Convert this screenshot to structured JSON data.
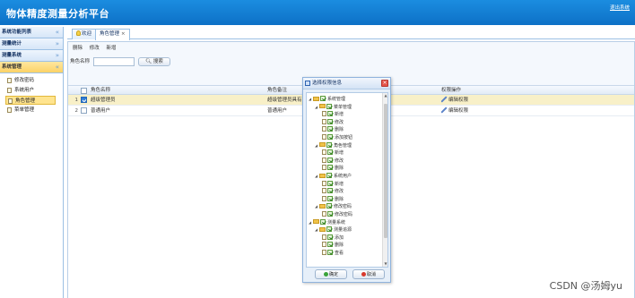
{
  "header": {
    "title": "物体精度测量分析平台",
    "logout": "退出系统"
  },
  "sidebar": {
    "sections": [
      {
        "label": "系统功能列表",
        "chev": "«"
      },
      {
        "label": "测量统计",
        "chev": "»"
      },
      {
        "label": "测量系统",
        "chev": "»"
      },
      {
        "label": "系统管理",
        "chev": "«"
      }
    ],
    "items": [
      {
        "label": "修改密码"
      },
      {
        "label": "系统用户"
      },
      {
        "label": "角色管理"
      },
      {
        "label": "菜单管理"
      }
    ]
  },
  "tabs": {
    "home": "欢迎",
    "active": "角色管理",
    "close": "×"
  },
  "toolbar": {
    "delete": "删除",
    "edit": "修改",
    "add": "新增"
  },
  "search": {
    "label": "角色名称",
    "button": "搜索"
  },
  "grid": {
    "headers": {
      "name": "角色名称",
      "note": "角色备注",
      "op": "权限操作"
    },
    "rows": [
      {
        "num": "1",
        "name": "超级管理员",
        "note": "超级管理员具有",
        "op": "编辑权限",
        "checked": true
      },
      {
        "num": "2",
        "name": "普通用户",
        "note": "普通用户",
        "op": "编辑权限",
        "checked": false
      }
    ]
  },
  "dialog": {
    "title": "选择权限信息",
    "close": "×",
    "tree": [
      {
        "label": "系统管理",
        "type": "folder",
        "level": 1,
        "toggle": "◢"
      },
      {
        "label": "菜单管理",
        "type": "folder",
        "level": 2,
        "toggle": "◢"
      },
      {
        "label": "新增",
        "type": "leaf",
        "level": 3
      },
      {
        "label": "修改",
        "type": "leaf",
        "level": 3
      },
      {
        "label": "删除",
        "type": "leaf",
        "level": 3
      },
      {
        "label": "添加按钮",
        "type": "leaf",
        "level": 3
      },
      {
        "label": "角色管理",
        "type": "folder",
        "level": 2,
        "toggle": "◢"
      },
      {
        "label": "新增",
        "type": "leaf",
        "level": 3
      },
      {
        "label": "修改",
        "type": "leaf",
        "level": 3
      },
      {
        "label": "删除",
        "type": "leaf",
        "level": 3
      },
      {
        "label": "系统用户",
        "type": "folder",
        "level": 2,
        "toggle": "◢"
      },
      {
        "label": "新增",
        "type": "leaf",
        "level": 3
      },
      {
        "label": "修改",
        "type": "leaf",
        "level": 3
      },
      {
        "label": "删除",
        "type": "leaf",
        "level": 3
      },
      {
        "label": "修改密码",
        "type": "folder",
        "level": 2,
        "toggle": "◢"
      },
      {
        "label": "修改密码",
        "type": "leaf",
        "level": 3
      },
      {
        "label": "测量系统",
        "type": "folder",
        "level": 1,
        "toggle": "◢"
      },
      {
        "label": "测量追源",
        "type": "folder",
        "level": 2,
        "toggle": "◢"
      },
      {
        "label": "添加",
        "type": "leaf",
        "level": 3
      },
      {
        "label": "删除",
        "type": "leaf",
        "level": 3
      },
      {
        "label": "查看",
        "type": "leaf",
        "level": 3
      }
    ],
    "ok": "确定",
    "cancel": "取消"
  },
  "watermark": "CSDN @汤姆yu"
}
